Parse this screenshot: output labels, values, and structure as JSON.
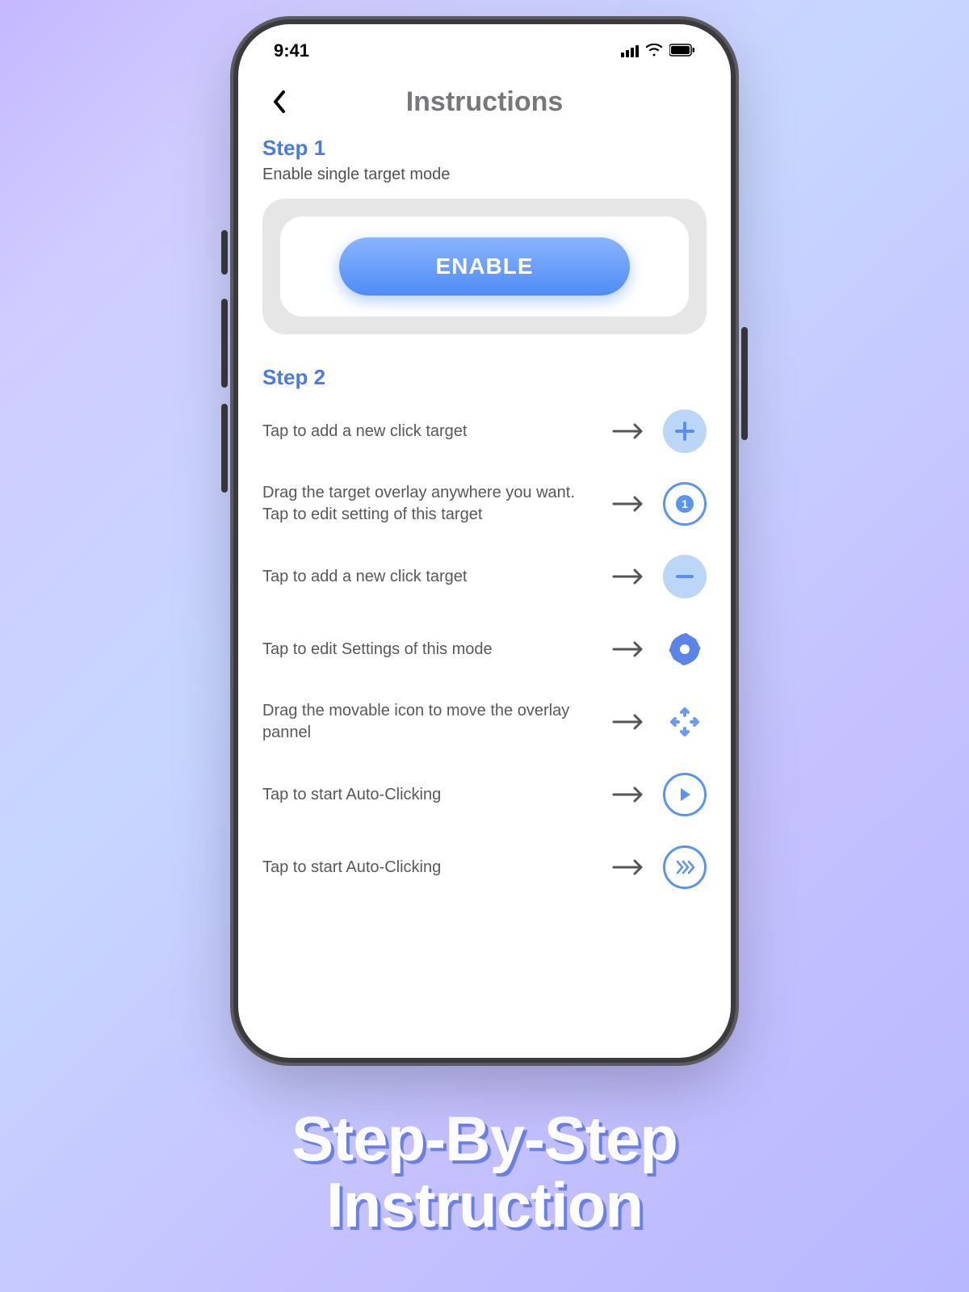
{
  "statusbar": {
    "time": "9:41"
  },
  "header": {
    "title": "Instructions"
  },
  "step1": {
    "label": "Step 1",
    "desc": "Enable single target mode",
    "button": "ENABLE"
  },
  "step2": {
    "label": "Step 2",
    "rows": [
      {
        "text": "Tap to add a new click target"
      },
      {
        "text": "Drag the target overlay anywhere you want. Tap to edit setting of this target",
        "num": "1"
      },
      {
        "text": "Tap to add a new click target"
      },
      {
        "text": "Tap to edit Settings of this mode"
      },
      {
        "text": "Drag the movable icon to move the overlay pannel"
      },
      {
        "text": "Tap to start Auto-Clicking"
      },
      {
        "text": "Tap to start Auto-Clicking"
      }
    ]
  },
  "caption": {
    "line1": "Step-By-Step",
    "line2": "Instruction"
  }
}
